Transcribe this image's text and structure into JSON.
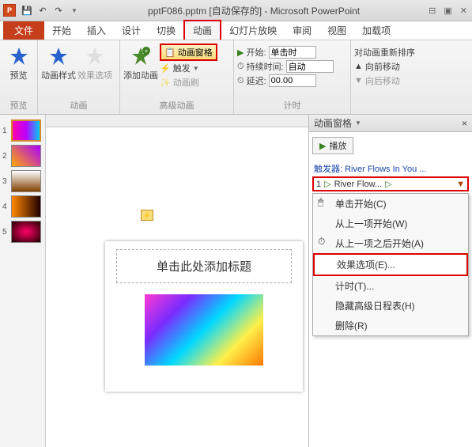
{
  "titlebar": {
    "app_icon": "P",
    "filename": "pptF086.pptm [自动保存的]",
    "app_name": "Microsoft PowerPoint"
  },
  "tabs": {
    "file": "文件",
    "home": "开始",
    "insert": "插入",
    "design": "设计",
    "transitions": "切换",
    "animations": "动画",
    "slideshow": "幻灯片放映",
    "review": "审阅",
    "view": "视图",
    "addins": "加载项"
  },
  "ribbon": {
    "preview": {
      "label": "预览",
      "group": "预览"
    },
    "anim_group": {
      "styles": "动画样式",
      "effect_opts": "效果选项",
      "group": "动画"
    },
    "adv_group": {
      "add_anim": "添加动画",
      "anim_pane": "动画窗格",
      "trigger": "触发",
      "painter": "动画刷",
      "group": "高级动画"
    },
    "timing_group": {
      "start_label": "开始:",
      "start_value": "单击时",
      "duration_label": "持续时间:",
      "duration_value": "自动",
      "delay_label": "延迟:",
      "delay_value": "00.00",
      "group": "计时"
    },
    "reorder": {
      "title": "对动画重新排序",
      "forward": "向前移动",
      "backward": "向后移动"
    }
  },
  "thumbs": [
    "1",
    "2",
    "3",
    "4",
    "5"
  ],
  "slide": {
    "title_placeholder": "单击此处添加标题"
  },
  "anim_pane": {
    "title": "动画窗格",
    "play": "播放",
    "trigger_label": "触发器: River Flows In You ...",
    "item_num": "1",
    "item_text": "River Flow...",
    "menu": {
      "click_start": "单击开始(C)",
      "with_prev": "从上一项开始(W)",
      "after_prev": "从上一项之后开始(A)",
      "effect_opts": "效果选项(E)...",
      "timing": "计时(T)...",
      "hide_timeline": "隐藏高级日程表(H)",
      "remove": "删除(R)"
    }
  }
}
